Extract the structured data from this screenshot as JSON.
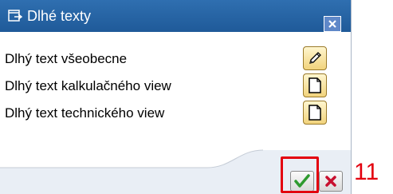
{
  "dialog": {
    "title": "Dlhé texty",
    "rows": [
      {
        "label": "Dlhý text všeobecne",
        "icon": "pencil-icon"
      },
      {
        "label": "Dlhý text kalkulačného view",
        "icon": "document-icon"
      },
      {
        "label": "Dlhý text technického view",
        "icon": "document-icon"
      }
    ]
  },
  "annotation": {
    "step": "11"
  },
  "colors": {
    "titlebar": "#2366a8",
    "footer": "#e9eef5",
    "highlight": "#e3000f",
    "ok_check": "#2e9a2e",
    "cancel_x": "#c8102e"
  }
}
